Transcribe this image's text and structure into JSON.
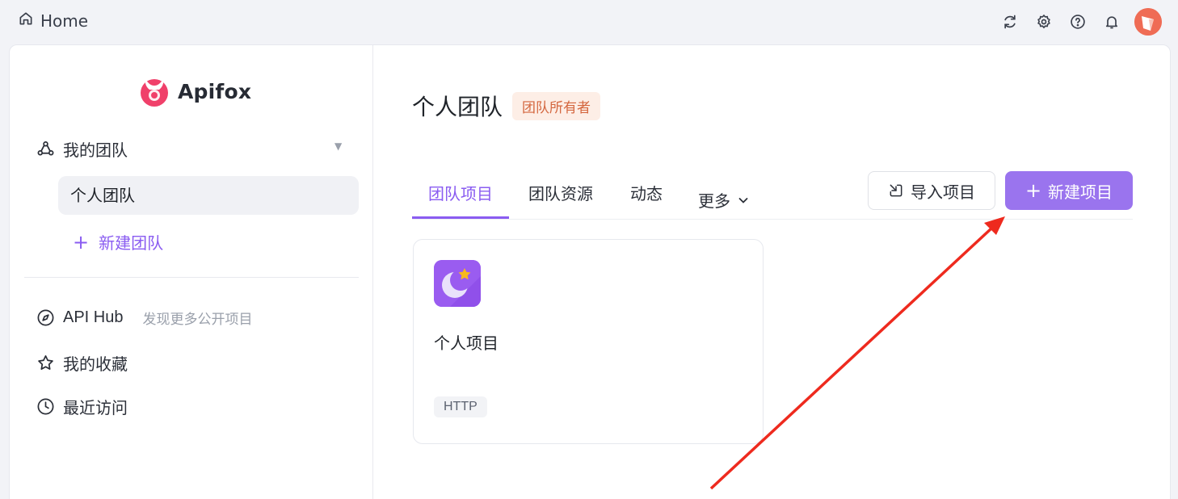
{
  "topbar": {
    "home_label": "Home",
    "icons": [
      "refresh-icon",
      "gear-icon",
      "help-icon",
      "bell-icon"
    ]
  },
  "sidebar": {
    "logo_text": "Apifox",
    "my_teams": "我的团队",
    "selected_team": "个人团队",
    "new_team": "新建团队",
    "api_hub": "API Hub",
    "api_hub_sub": "发现更多公开项目",
    "favorites": "我的收藏",
    "recent": "最近访问"
  },
  "main": {
    "title": "个人团队",
    "owner_badge": "团队所有者",
    "tabs": [
      {
        "label": "团队项目",
        "active": true
      },
      {
        "label": "团队资源",
        "active": false
      },
      {
        "label": "动态",
        "active": false
      },
      {
        "label": "更多",
        "active": false
      }
    ],
    "import_button": "导入项目",
    "new_button": "新建项目",
    "project_card": {
      "name": "个人项目",
      "tag": "HTTP"
    }
  },
  "colors": {
    "accent": "#8a5cf1",
    "button_primary": "#9a74ee",
    "badge_bg": "#fdeee6",
    "badge_text": "#d4673f",
    "annotation_arrow": "#ee2a1e"
  }
}
